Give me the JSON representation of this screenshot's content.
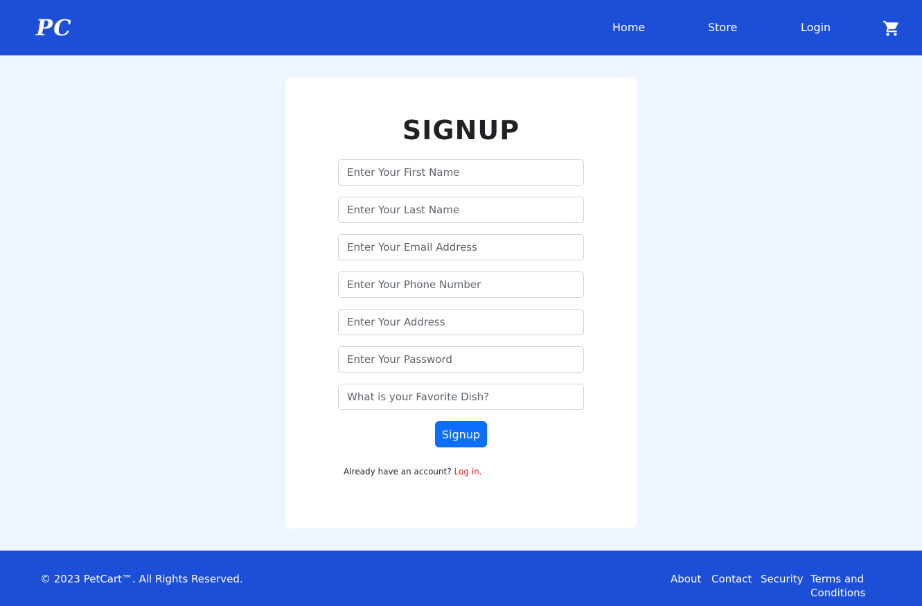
{
  "header": {
    "logo": "PC",
    "nav": [
      {
        "label": "Home"
      },
      {
        "label": "Store"
      },
      {
        "label": "Login"
      }
    ]
  },
  "form": {
    "title": "SIGNUP",
    "fields": [
      {
        "placeholder": "Enter Your First Name",
        "value": ""
      },
      {
        "placeholder": "Enter Your Last Name",
        "value": ""
      },
      {
        "placeholder": "Enter Your Email Address",
        "value": ""
      },
      {
        "placeholder": "Enter Your Phone Number",
        "value": ""
      },
      {
        "placeholder": "Enter Your Address",
        "value": ""
      },
      {
        "placeholder": "Enter Your Password",
        "value": ""
      },
      {
        "placeholder": "What is your Favorite Dish?",
        "value": ""
      }
    ],
    "submit_label": "Signup",
    "account_prompt": "Already have an account?",
    "login_link": "Log in."
  },
  "footer": {
    "copyright": "© 2023 PetCart™. All Rights Reserved.",
    "links": [
      {
        "label": "About"
      },
      {
        "label": "Contact"
      },
      {
        "label": "Security"
      },
      {
        "label": "Terms and Conditions"
      }
    ]
  },
  "colors": {
    "brand": "#1d4ed8",
    "page_background": "#eff6ff",
    "button": "#0d6efd",
    "login_link": "#e11d1d"
  },
  "icons": {
    "cart": "shopping-cart-icon"
  }
}
